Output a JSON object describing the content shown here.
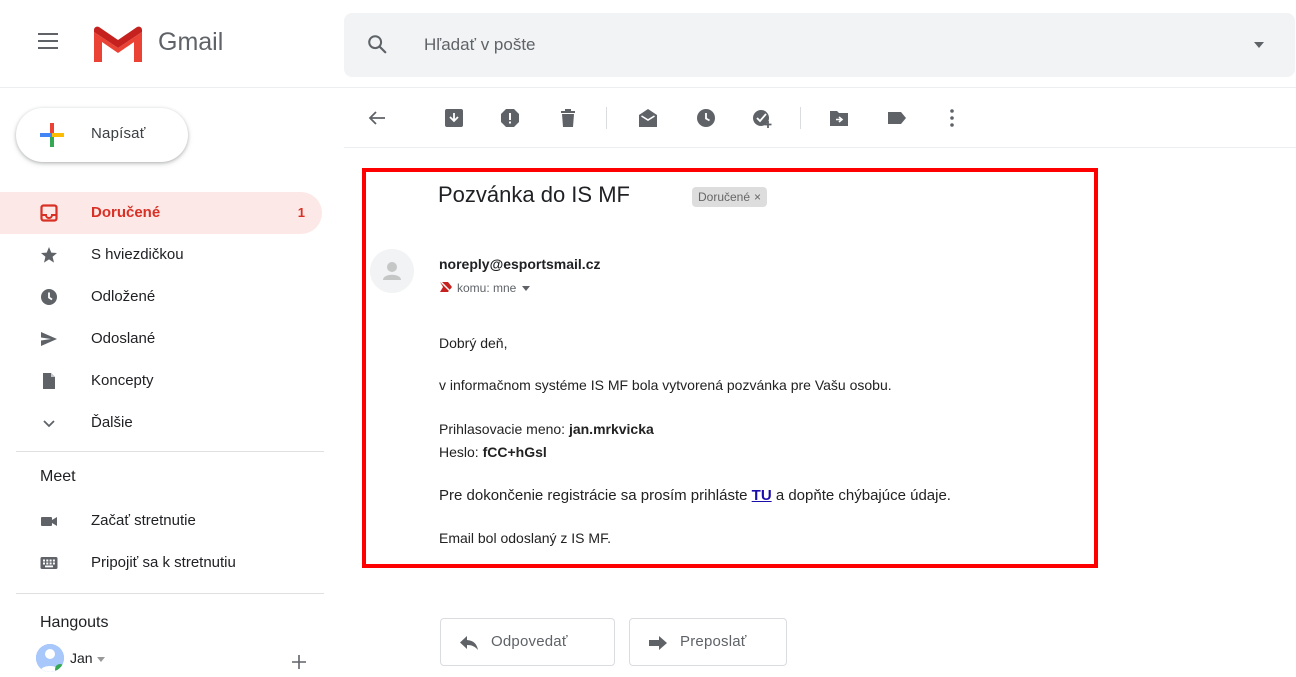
{
  "header": {
    "app_name": "Gmail",
    "search_placeholder": "Hľadať v pošte"
  },
  "sidebar": {
    "compose_label": "Napísať",
    "items": [
      {
        "label": "Doručené",
        "count": "1",
        "icon": "inbox-icon",
        "active": true
      },
      {
        "label": "S hviezdičkou",
        "icon": "star-icon"
      },
      {
        "label": "Odložené",
        "icon": "clock-icon"
      },
      {
        "label": "Odoslané",
        "icon": "send-icon"
      },
      {
        "label": "Koncepty",
        "icon": "draft-icon"
      },
      {
        "label": "Ďalšie",
        "icon": "chevron-down-icon"
      }
    ],
    "meet": {
      "title": "Meet",
      "items": [
        {
          "label": "Začať stretnutie",
          "icon": "videocam-icon"
        },
        {
          "label": "Pripojiť sa k stretnutiu",
          "icon": "keyboard-icon"
        }
      ]
    },
    "hangouts": {
      "title": "Hangouts",
      "user": "Jan"
    }
  },
  "toolbar": {
    "icons": [
      "back-arrow-icon",
      "archive-icon",
      "report-spam-icon",
      "delete-icon",
      "mark-unread-icon",
      "snooze-icon",
      "add-to-tasks-icon",
      "move-to-icon",
      "label-icon",
      "more-options-icon"
    ]
  },
  "email": {
    "subject": "Pozvánka do IS MF",
    "label_chip": "Doručené",
    "label_chip_close": "×",
    "sender": "noreply@esportsmail.cz",
    "recipient": "komu: mne",
    "greeting": "Dobrý deň,",
    "line1": "v informačnom systéme IS MF bola vytvorená pozvánka pre Vašu osobu.",
    "login_label": "Prihlasovacie meno:",
    "login_value": "jan.mrkvicka",
    "password_label": "Heslo:",
    "password_value": "fCC+hGsl",
    "line3_before": "Pre dokončenie registrácie sa prosím prihláste",
    "line3_link": "TU",
    "line3_after": "a dopňte chýbajúce údaje.",
    "footer": "Email bol odoslaný z IS MF."
  },
  "actions": {
    "reply": "Odpovedať",
    "forward": "Preposlať"
  },
  "colors": {
    "accent_red": "#d93025",
    "highlight_frame": "#ff0000",
    "active_bg": "#fce8e6",
    "link": "#1a0dab"
  }
}
